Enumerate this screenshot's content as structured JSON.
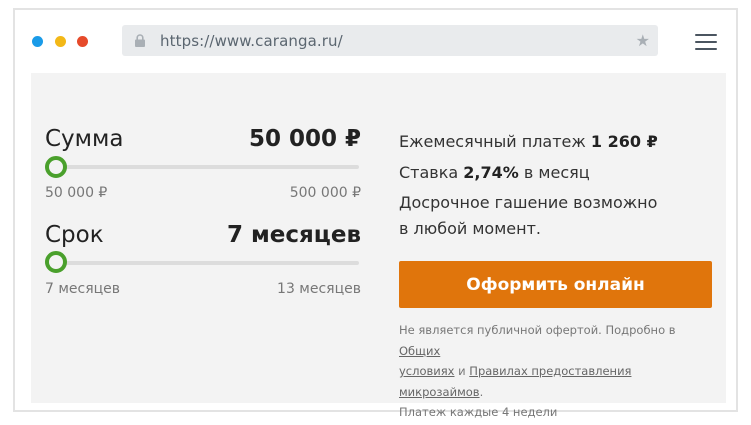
{
  "browser": {
    "url": "https://www.caranga.ru/",
    "icons": {
      "lock": "lock-icon",
      "star": "star-icon",
      "menu": "hamburger-menu-icon"
    }
  },
  "calculator": {
    "amount": {
      "label": "Сумма",
      "value": "50 000 ₽",
      "min": "50 000 ₽",
      "max": "500 000 ₽",
      "slider_position": 0
    },
    "term": {
      "label": "Срок",
      "value": "7 месяцев",
      "min": "7 месяцев",
      "max": "13 месяцев",
      "slider_position": 0
    }
  },
  "info": {
    "payment_prefix": "Ежемесячный платеж",
    "payment_value": "1 260 ₽",
    "rate_prefix": "Ставка",
    "rate_value": "2,74%",
    "rate_suffix": "в месяц",
    "early_line1": "Досрочное гашение возможно",
    "early_line2": "в любой момент."
  },
  "cta": {
    "label": "Оформить онлайн"
  },
  "disclaimer": {
    "text1": "Не является публичной офертой. Подробно в",
    "link1_line1": "Общих",
    "link1_line2": "условиях",
    "text2": "и",
    "link2": "Правилах предоставления микрозаймов",
    "text3": ".",
    "text4": "Платеж каждые 4 недели"
  },
  "colors": {
    "accent": "#e0750c",
    "slider": "#4aa02c",
    "dot_blue": "#1a9be8",
    "dot_yellow": "#f3b817",
    "dot_red": "#e64a2a"
  }
}
